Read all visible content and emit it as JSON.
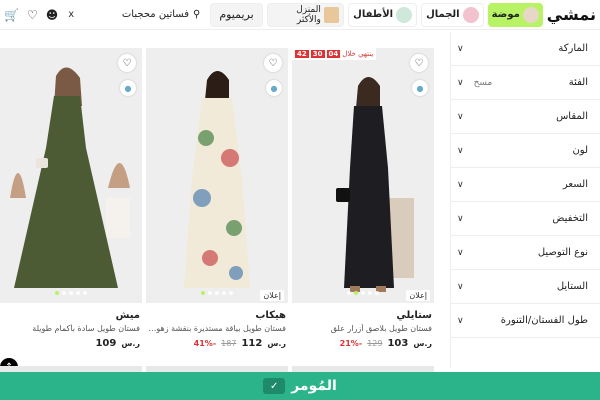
{
  "header": {
    "logo": "نمشي",
    "categories": [
      {
        "label": "موضة",
        "style": "mode"
      },
      {
        "label": "الجمال",
        "style": "beauty"
      },
      {
        "label": "الأطفال",
        "style": "kids"
      },
      {
        "label": "المنزل والأكثر",
        "style": "home"
      }
    ],
    "premium_label": "بريميوم",
    "search": {
      "value": "فساتين محجبات",
      "clear": "x"
    }
  },
  "sidebar": {
    "top_label": "",
    "filters": [
      {
        "label": "الماركة",
        "extra": ""
      },
      {
        "label": "الفئة",
        "extra": "مسح"
      },
      {
        "label": "المقاس",
        "extra": ""
      },
      {
        "label": "لون",
        "extra": ""
      },
      {
        "label": "السعر",
        "extra": ""
      },
      {
        "label": "التخفيض",
        "extra": ""
      },
      {
        "label": "نوع التوصيل",
        "extra": ""
      },
      {
        "label": "الستايل",
        "extra": ""
      },
      {
        "label": "طول الفستان/التنورة",
        "extra": ""
      }
    ]
  },
  "products": [
    {
      "brand": "ستايلي",
      "desc": "فستان طويل بلاصق أزرار علق",
      "price": "103",
      "old_price": "129",
      "discount": "-21%",
      "ad": "إعلان",
      "timer": {
        "label": "ينتهي خلال",
        "h": "04",
        "m": "30",
        "s": "42"
      }
    },
    {
      "brand": "هيكاب",
      "desc": "فستان طويل بياقة مستديرة بنقشة زهور ومقاس",
      "price": "112",
      "old_price": "187",
      "discount": "-41%",
      "ad": "إعلان"
    },
    {
      "brand": "ميش",
      "desc": "فستان طويل سادة بأكمام طويلة",
      "price": "109",
      "old_price": "",
      "discount": ""
    }
  ],
  "banner": {
    "text": "المُومر"
  },
  "currency_symbol": "ر.س"
}
